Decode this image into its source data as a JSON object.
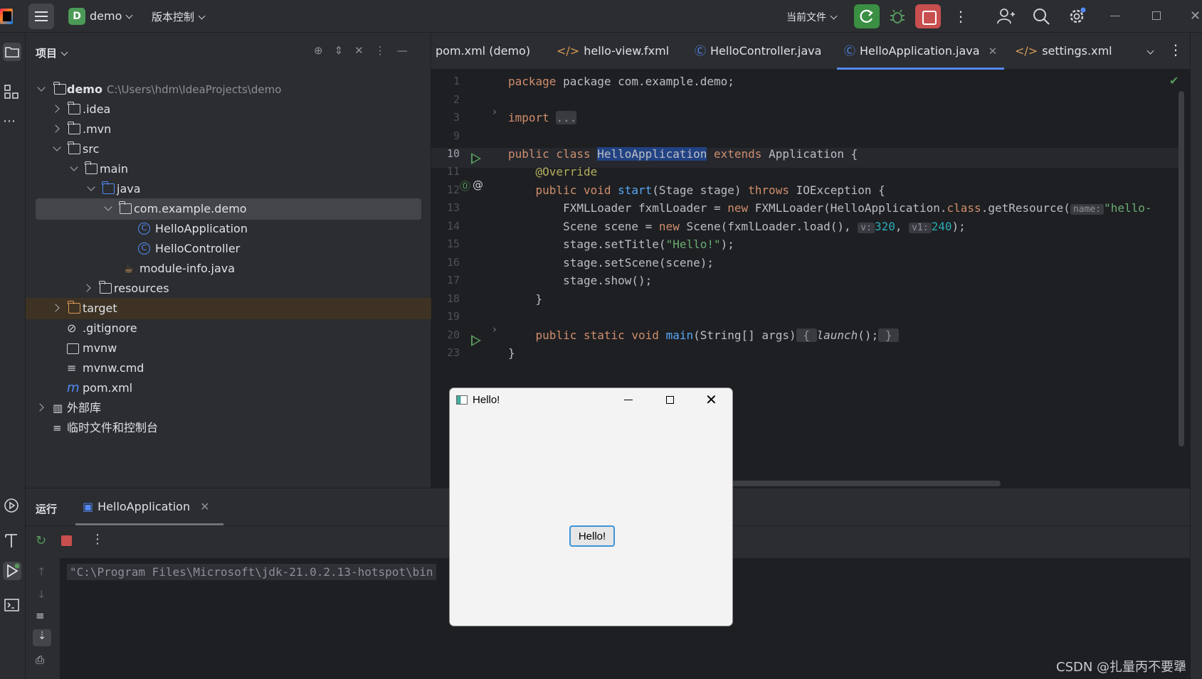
{
  "topbar": {
    "project_badge": "D",
    "project_name": "demo",
    "vcs_label": "版本控制",
    "current_file_label": "当前文件"
  },
  "project_panel": {
    "header": "项目",
    "root_name": "demo",
    "root_path": "C:\\Users\\hdm\\IdeaProjects\\demo",
    "items": [
      {
        "label": ".idea"
      },
      {
        "label": ".mvn"
      },
      {
        "label": "src"
      },
      {
        "label": "main"
      },
      {
        "label": "java"
      },
      {
        "label": "com.example.demo"
      },
      {
        "label": "HelloApplication"
      },
      {
        "label": "HelloController"
      },
      {
        "label": "module-info.java"
      },
      {
        "label": "resources"
      },
      {
        "label": "target"
      },
      {
        "label": ".gitignore"
      },
      {
        "label": "mvnw"
      },
      {
        "label": "mvnw.cmd"
      },
      {
        "label": "pom.xml"
      },
      {
        "label": "外部库"
      },
      {
        "label": "临时文件和控制台"
      }
    ]
  },
  "tabs": [
    {
      "label": "pom.xml (demo)"
    },
    {
      "label": "hello-view.fxml"
    },
    {
      "label": "HelloController.java"
    },
    {
      "label": "HelloApplication.java"
    },
    {
      "label": "settings.xml"
    }
  ],
  "editor": {
    "line_numbers": [
      "1",
      "2",
      "3",
      "9",
      "10",
      "11",
      "12",
      "13",
      "14",
      "15",
      "16",
      "17",
      "18",
      "19",
      "20",
      "23"
    ],
    "code": {
      "l1": "package com.example.demo;",
      "l3_kw": "import",
      "l3_fold": "...",
      "l10_a": "public class ",
      "l10_cls": "HelloApplication",
      "l10_b": " extends ",
      "l10_c": "Application {",
      "l11": "@Override",
      "l12_a": "public void ",
      "l12_fn": "start",
      "l12_b": "(Stage stage) ",
      "l12_kw": "throws",
      "l12_c": " IOException {",
      "l13_a": "FXMLLoader fxmlLoader = ",
      "l13_kw": "new",
      "l13_b": " FXMLLoader(HelloApplication.",
      "l13_cls": "class",
      "l13_c": ".getResource(",
      "l13_hint": "name:",
      "l13_str": "\"hello-",
      "l14_a": "Scene scene = ",
      "l14_kw": "new",
      "l14_b": " Scene(fxmlLoader.load(), ",
      "l14_hint1": "v:",
      "l14_n1": "320",
      "l14_c": ", ",
      "l14_hint2": "v1:",
      "l14_n2": "240",
      "l14_d": ");",
      "l15_a": "stage.setTitle(",
      "l15_str": "\"Hello!\"",
      "l15_b": ");",
      "l16": "stage.setScene(scene);",
      "l17": "stage.show();",
      "l18": "}",
      "l20_a": "public static void ",
      "l20_fn": "main",
      "l20_b": "(String[] args)",
      "l20_f1": " { ",
      "l20_it": "launch",
      "l20_c": "();",
      "l20_f2": " } ",
      "l23": "}"
    }
  },
  "run_panel": {
    "title": "运行",
    "tab_label": "HelloApplication",
    "console_line": "\"C:\\Program Files\\Microsoft\\jdk-21.0.2.13-hotspot\\bin"
  },
  "hello_window": {
    "title": "Hello!",
    "button_label": "Hello!"
  },
  "watermark": "CSDN @扎量丙不要犟"
}
